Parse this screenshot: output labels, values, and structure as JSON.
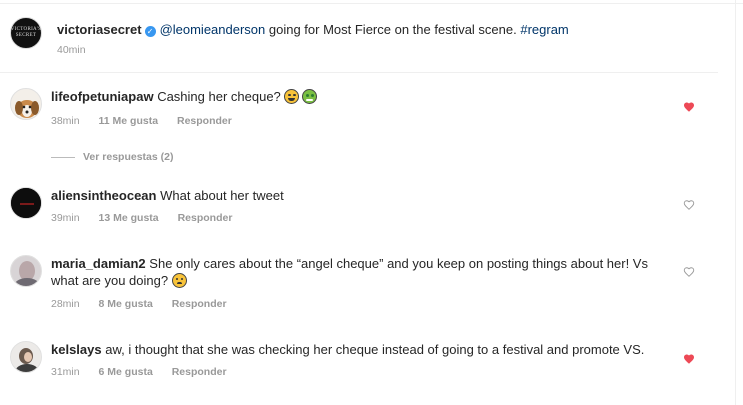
{
  "post": {
    "author": "victoriasecret",
    "avatar_text": "VICTORIA'S SECRET",
    "mention": "@leomieanderson",
    "caption": " going for Most Fierce on the festival scene. ",
    "hashtag": "#regram",
    "time": "40min"
  },
  "comments": [
    {
      "username": "lifeofpetuniapaw",
      "text": "Cashing her cheque?",
      "emojis": [
        "face-with-tears-of-joy",
        "money-mouth-face"
      ],
      "time": "38min",
      "likes": "11 Me gusta",
      "reply": "Responder",
      "liked": true,
      "view_replies": "Ver respuestas (2)"
    },
    {
      "username": "aliensintheocean",
      "text": "What about her tweet",
      "time": "39min",
      "likes": "13 Me gusta",
      "reply": "Responder",
      "liked": false
    },
    {
      "username": "maria_damian2",
      "text": "She only cares about the “angel cheque” and you keep on posting things about her! Vs",
      "text_line2": "what are you doing?",
      "emojis": [
        "sad-face"
      ],
      "time": "28min",
      "likes": "8 Me gusta",
      "reply": "Responder",
      "liked": false
    },
    {
      "username": "kelslays",
      "text": "aw, i thought that she was checking her cheque instead of going to a festival and promote VS.",
      "time": "31min",
      "likes": "6 Me gusta",
      "reply": "Responder",
      "liked": true
    }
  ],
  "colors": {
    "heart_liked": "#ed4956",
    "heart_unliked": "#999999",
    "link": "#003569",
    "verified": "#3897f0"
  }
}
